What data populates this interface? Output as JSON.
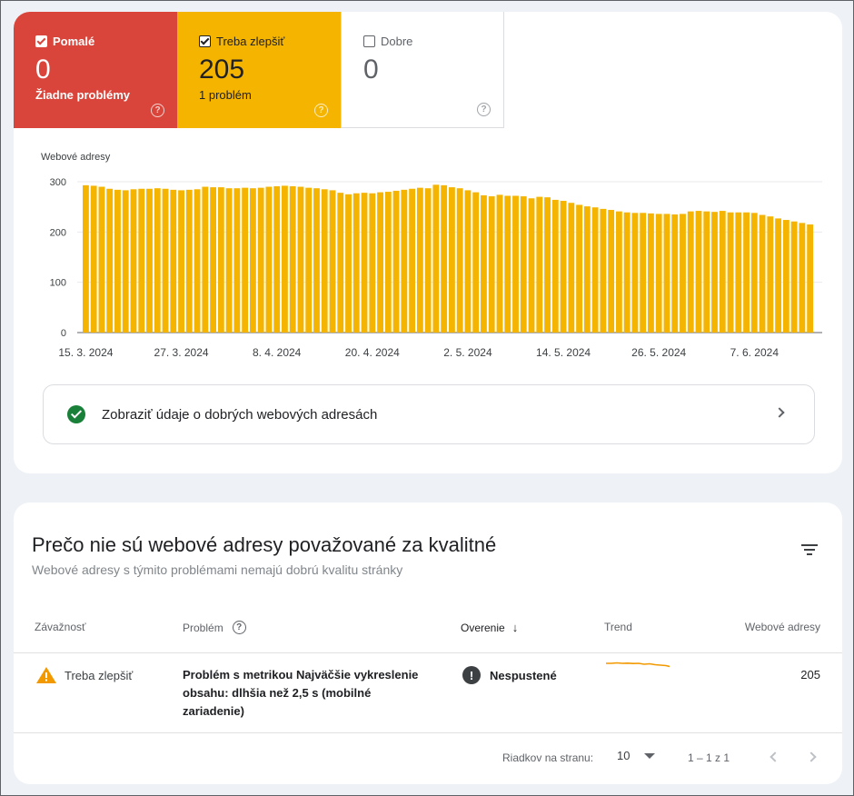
{
  "summary": {
    "slow": {
      "label": "Pomalé",
      "count": "0",
      "sub": "Žiadne problémy",
      "checked": true,
      "color": "#d9453b"
    },
    "improve": {
      "label": "Treba zlepšiť",
      "count": "205",
      "sub": "1 problém",
      "checked": true,
      "color": "#f4b400"
    },
    "good": {
      "label": "Dobre",
      "count": "0",
      "checked": false
    }
  },
  "chart_data": {
    "type": "bar",
    "ylabel": "Webové adresy",
    "ylim": [
      0,
      300
    ],
    "yticks": [
      0,
      100,
      200,
      300
    ],
    "xticks": [
      "15. 3. 2024",
      "27. 3. 2024",
      "8. 4. 2024",
      "20. 4. 2024",
      "2. 5. 2024",
      "14. 5. 2024",
      "26. 5. 2024",
      "7. 6. 2024"
    ],
    "color": "#f4b400",
    "grid": true,
    "values": [
      293,
      292,
      290,
      286,
      284,
      283,
      285,
      286,
      286,
      287,
      286,
      284,
      283,
      284,
      285,
      290,
      289,
      289,
      287,
      287,
      288,
      287,
      288,
      290,
      291,
      292,
      291,
      290,
      288,
      287,
      285,
      283,
      278,
      275,
      277,
      278,
      277,
      279,
      280,
      282,
      284,
      286,
      288,
      287,
      294,
      293,
      289,
      287,
      283,
      279,
      273,
      271,
      274,
      272,
      272,
      271,
      267,
      270,
      269,
      264,
      262,
      258,
      254,
      251,
      249,
      246,
      244,
      241,
      239,
      238,
      238,
      237,
      236,
      236,
      235,
      236,
      241,
      242,
      241,
      240,
      242,
      239,
      239,
      239,
      238,
      234,
      231,
      227,
      224,
      221,
      218,
      215
    ],
    "xtick_index": [
      0,
      12,
      24,
      36,
      48,
      60,
      72,
      84
    ]
  },
  "good_link": {
    "label": "Zobraziť údaje o dobrých webových adresách"
  },
  "issues": {
    "title": "Prečo nie sú webové adresy považované za kvalitné",
    "subtitle": "Webové adresy s týmito problémami nemajú dobrú kvalitu stránky",
    "headers": {
      "severity": "Závažnosť",
      "problem": "Problém",
      "validation": "Overenie",
      "trend": "Trend",
      "urls": "Webové adresy"
    },
    "rows": [
      {
        "severity": "Treba zlepšiť",
        "problem": "Problém s metrikou Najväčšie vykreslenie obsahu: dlhšia než 2,5 s (mobilné zariadenie)",
        "validation": "Nespustené",
        "urls": "205"
      }
    ],
    "pager": {
      "rows_label": "Riadkov na stranu:",
      "rows_value": "10",
      "range": "1 – 1 z 1"
    }
  }
}
